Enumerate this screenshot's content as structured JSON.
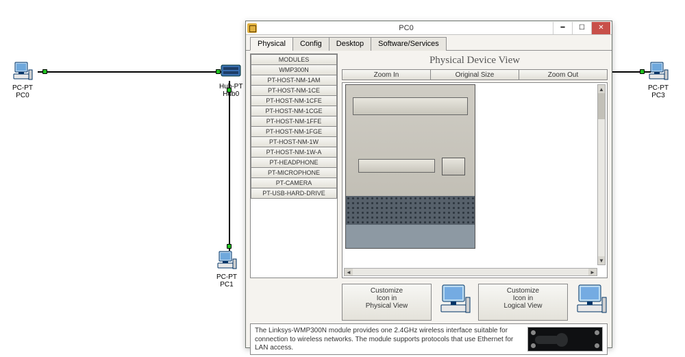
{
  "topology": {
    "pc0": {
      "type": "PC-PT",
      "name": "PC0"
    },
    "pc1": {
      "type": "PC-PT",
      "name": "PC1"
    },
    "pc3": {
      "type": "PC-PT",
      "name": "PC3"
    },
    "hub": {
      "type": "Hub-PT",
      "name": "Hub0"
    }
  },
  "window": {
    "title": "PC0",
    "tabs": [
      "Physical",
      "Config",
      "Desktop",
      "Software/Services"
    ],
    "active_tab": "Physical",
    "modules": [
      "MODULES",
      "WMP300N",
      "PT-HOST-NM-1AM",
      "PT-HOST-NM-1CE",
      "PT-HOST-NM-1CFE",
      "PT-HOST-NM-1CGE",
      "PT-HOST-NM-1FFE",
      "PT-HOST-NM-1FGE",
      "PT-HOST-NM-1W",
      "PT-HOST-NM-1W-A",
      "PT-HEADPHONE",
      "PT-MICROPHONE",
      "PT-CAMERA",
      "PT-USB-HARD-DRIVE"
    ],
    "physical_view_header": "Physical Device View",
    "zoom": [
      "Zoom In",
      "Original Size",
      "Zoom Out"
    ],
    "customize_physical": "Customize\nIcon in\nPhysical View",
    "customize_logical": "Customize\nIcon in\nLogical View",
    "description": "The Linksys-WMP300N module provides one 2.4GHz wireless interface suitable for connection to wireless networks. The module supports protocols that use Ethernet for LAN access."
  }
}
